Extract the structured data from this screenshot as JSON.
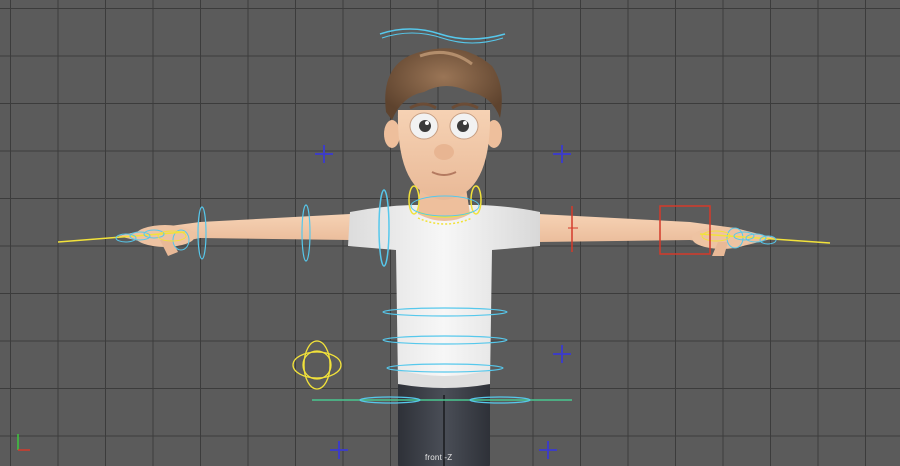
{
  "viewport": {
    "camera_label": "front -Z"
  },
  "icons": {
    "axis": "axis-gizmo-icon",
    "locator": "cross-locator-icon"
  },
  "colors": {
    "grid_bg": "#5b5b5b",
    "grid_line": "#3c3c3c",
    "control_cyan": "#56c8ec",
    "control_yellow": "#f2e23a",
    "control_blue": "#3d3dc4",
    "control_red": "#d43a2a",
    "control_green": "#49c890",
    "skin": "#f2c9a8",
    "shirt": "#f4f4f4",
    "hair": "#7a5a40",
    "pants": "#3a3d44"
  }
}
